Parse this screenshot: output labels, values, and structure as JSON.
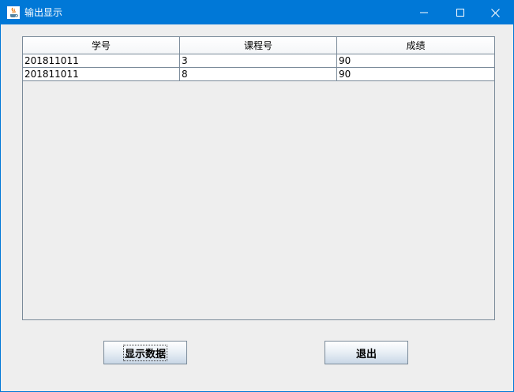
{
  "window": {
    "title": "输出显示",
    "controls": [
      "minimize-icon",
      "maximize-icon",
      "close-icon"
    ],
    "accent_color": "#0078d7"
  },
  "table": {
    "columns": [
      "学号",
      "课程号",
      "成绩"
    ],
    "rows": [
      [
        "201811011",
        "3",
        "90"
      ],
      [
        "201811011",
        "8",
        "90"
      ]
    ]
  },
  "buttons": {
    "show_label": "显示数据",
    "exit_label": "退出"
  }
}
